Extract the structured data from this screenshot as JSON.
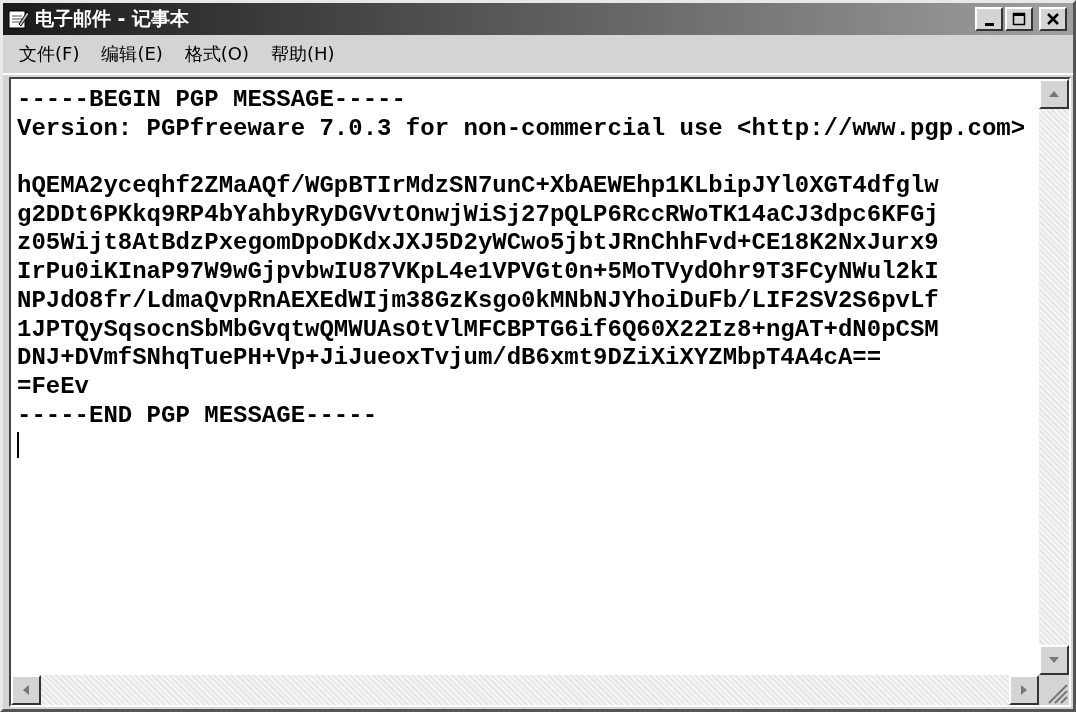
{
  "window": {
    "title": "电子邮件 - 记事本"
  },
  "menu": [
    {
      "label": "文件(F)"
    },
    {
      "label": "编辑(E)"
    },
    {
      "label": "格式(O)"
    },
    {
      "label": "帮助(H)"
    }
  ],
  "document": {
    "blocks": [
      [
        "-----BEGIN PGP MESSAGE-----",
        "Version: PGPfreeware 7.0.3 for non-commercial use <http://www.pgp.com>"
      ],
      [
        "hQEMA2yceqhf2ZMaAQf/WGpBTIrMdzSN7unC+XbAEWEhp1KLbipJYl0XGT4dfglw",
        "g2DDt6PKkq9RP4bYahbyRyDGVvtOnwjWiSj27pQLP6RccRWoTK14aCJ3dpc6KFGj",
        "z05Wijt8AtBdzPxegomDpoDKdxJXJ5D2yWCwo5jbtJRnChhFvd+CE18K2NxJurx9",
        "IrPu0iKInaP97W9wGjpvbwIU87VKpL4e1VPVGt0n+5MoTVydOhr9T3FCyNWul2kI",
        "NPJdO8fr/LdmaQvpRnAEXEdWIjm38GzKsgo0kMNbNJYhoiDuFb/LIF2SV2S6pvLf",
        "1JPTQySqsocnSbMbGvqtwQMWUAsOtVlMFCBPTG6if6Q60X22Iz8+ngAT+dN0pCSM",
        "DNJ+DVmfSNhqTuePH+Vp+JiJueoxTvjum/dB6xmt9DZiXiXYZMbpT4A4cA==",
        "=FeEv",
        "-----END PGP MESSAGE-----"
      ]
    ]
  }
}
